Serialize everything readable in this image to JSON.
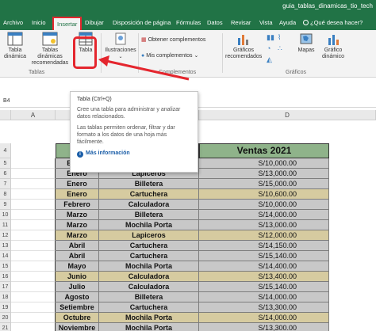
{
  "window": {
    "title": "guia_tablas_dinamicas_tio_tech"
  },
  "tabs": [
    {
      "label": "Archivo"
    },
    {
      "label": "Inicio"
    },
    {
      "label": "Insertar"
    },
    {
      "label": "Dibujar"
    },
    {
      "label": "Disposición de página"
    },
    {
      "label": "Fórmulas"
    },
    {
      "label": "Datos"
    },
    {
      "label": "Revisar"
    },
    {
      "label": "Vista"
    },
    {
      "label": "Ayuda"
    }
  ],
  "tell_me": "¿Qué desea hacer?",
  "ribbon": {
    "tabla_dinamica": "Tabla dinámica",
    "tablas_recomendadas": "Tablas dinámicas recomendadas",
    "tabla": "Tabla",
    "ilustraciones": "Ilustraciones",
    "obtener_complementos": "Obtener complementos",
    "mis_complementos": "Mis complementos",
    "graficos_recomendados": "Gráficos recomendados",
    "mapas": "Mapas",
    "grafico_dinamico": "Gráfico dinámico",
    "groups": {
      "tablas": "Tablas",
      "complementos": "Complementos",
      "graficos": "Gráficos"
    }
  },
  "namebox": "B4",
  "columns": [
    "A",
    "B",
    "C",
    "D"
  ],
  "rows": [
    "4",
    "5",
    "6",
    "7",
    "8",
    "9",
    "10",
    "11",
    "12",
    "13",
    "14",
    "15",
    "16",
    "17",
    "18",
    "19",
    "20",
    "21"
  ],
  "table": {
    "header_fecha": "Fe",
    "header_ventas": "Ventas 2021",
    "months": [
      "Enero",
      "Enero",
      "Enero",
      "Enero",
      "Febrero",
      "Marzo",
      "Marzo",
      "Marzo",
      "Abril",
      "Abril",
      "Mayo",
      "Junio",
      "Julio",
      "Agosto",
      "Setiembre",
      "Octubre",
      "Noviembre"
    ],
    "products": [
      "Borrador",
      "Lapiceros",
      "Billetera",
      "Cartuchera",
      "Calculadora",
      "Billetera",
      "Mochila Porta",
      "Lapiceros",
      "Cartuchera",
      "Cartuchera",
      "Mochila Porta",
      "Calculadora",
      "Calculadora",
      "Billetera",
      "Cartuchera",
      "Mochila Porta",
      "Mochila Porta"
    ],
    "amounts": [
      "S/10,000.00",
      "S/13,000.00",
      "S/15,000.00",
      "S/10,600.00",
      "S/10,000.00",
      "S/14,000.00",
      "S/13,000.00",
      "S/12,000.00",
      "S/14,150.00",
      "S/15,140.00",
      "S/14,400.00",
      "S/13,400.00",
      "S/15,140.00",
      "S/14,000.00",
      "S/13,300.00",
      "S/14,000.00",
      "S/13,300.00"
    ]
  },
  "tooltip": {
    "title": "Tabla (Ctrl+Q)",
    "line1": "Cree una tabla para administrar y analizar datos relacionados.",
    "line2": "Las tablas permiten ordenar, filtrar y dar formato a los datos de una hoja más fácilmente.",
    "more": "Más información"
  },
  "colors": {
    "excel_green": "#217346",
    "highlight_red": "#e4262e",
    "header_green": "#8fb38a",
    "row_beige": "#d6cba0",
    "row_gray": "#c8c8c8",
    "link_blue": "#1b5ea8"
  }
}
